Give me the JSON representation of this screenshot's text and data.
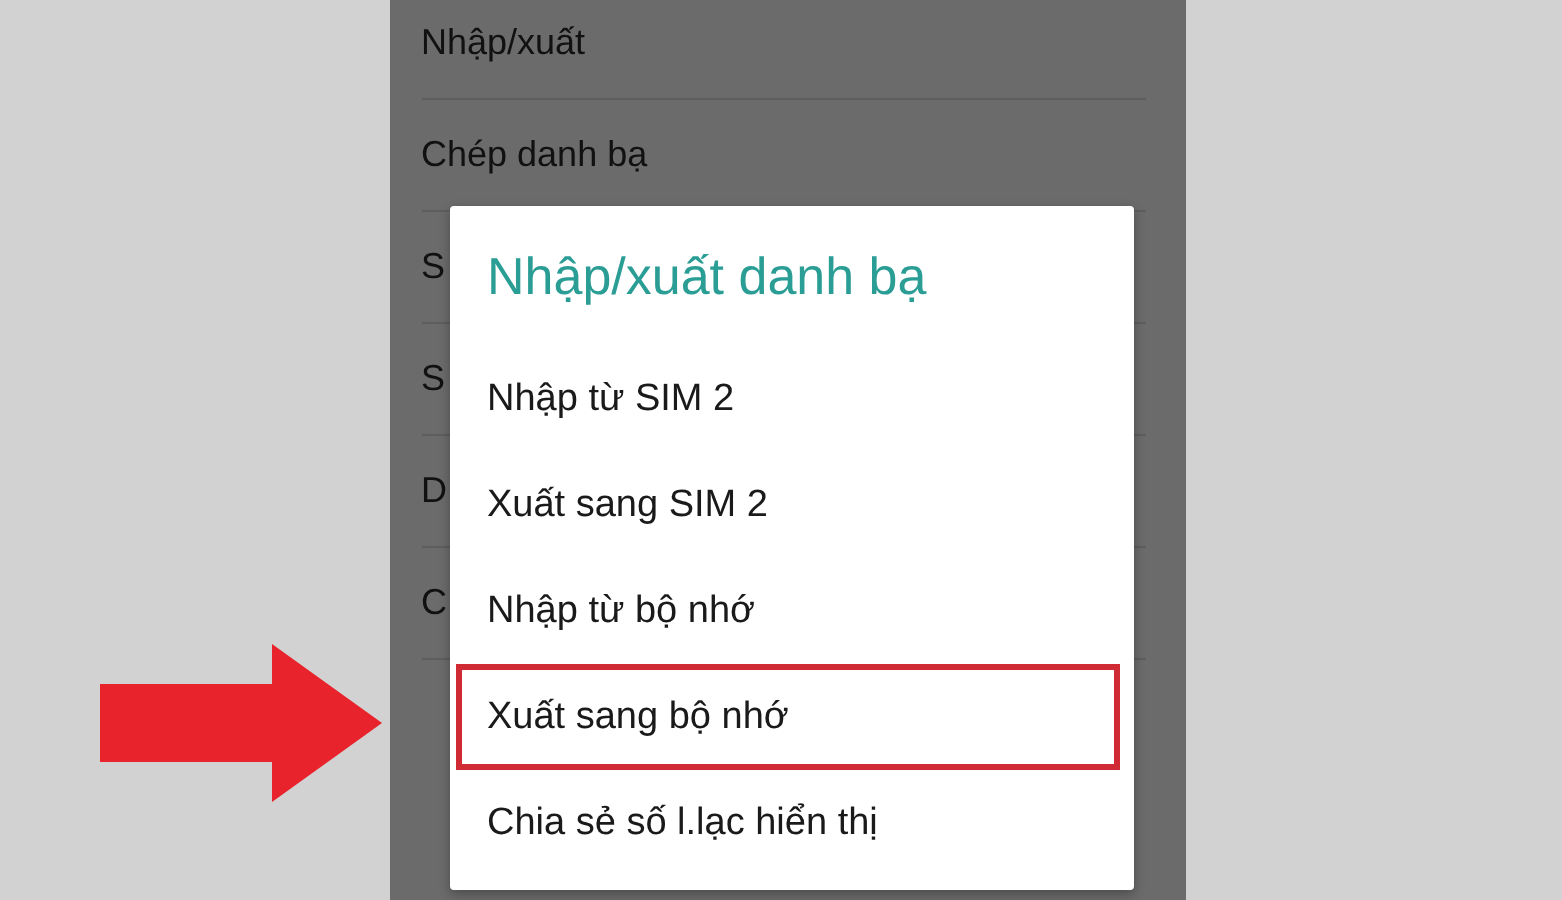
{
  "background_list": [
    {
      "label": "Nhập/xuất"
    },
    {
      "label": "Chép danh bạ"
    },
    {
      "label": "S"
    },
    {
      "label": "S"
    },
    {
      "label": "D"
    },
    {
      "label": "C"
    }
  ],
  "dialog": {
    "title": "Nhập/xuất danh bạ",
    "items": [
      {
        "label": "Nhập từ SIM 2",
        "highlighted": false
      },
      {
        "label": "Xuất sang SIM 2",
        "highlighted": false
      },
      {
        "label": "Nhập từ bộ nhớ",
        "highlighted": false
      },
      {
        "label": "Xuất sang bộ nhớ",
        "highlighted": true
      },
      {
        "label": "Chia sẻ số l.lạc hiển thị",
        "highlighted": false
      }
    ]
  }
}
